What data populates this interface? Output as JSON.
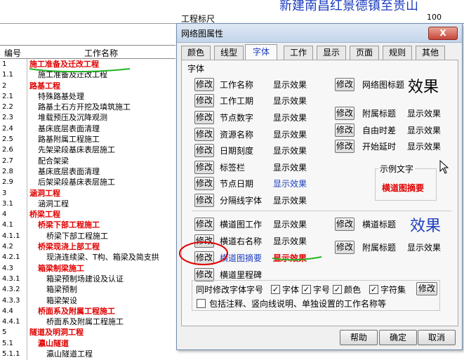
{
  "background": {
    "title": "新建南昌红景德镇至贵山",
    "gongcheng_label": "工程标尺",
    "gongcheng_value": "100",
    "headers": {
      "code": "编号",
      "name": "工作名称"
    },
    "rows": [
      {
        "code": "1",
        "name": "施工准备及迁改工程",
        "red": true,
        "indent": 0
      },
      {
        "code": "1.1",
        "name": "施工准备及迁改工程",
        "red": false,
        "indent": 1
      },
      {
        "code": "2",
        "name": "路基工程",
        "red": true,
        "indent": 0
      },
      {
        "code": "2.1",
        "name": "特殊路基处理",
        "red": false,
        "indent": 1
      },
      {
        "code": "2.2",
        "name": "路基土石方开挖及填筑施工",
        "red": false,
        "indent": 1
      },
      {
        "code": "2.3",
        "name": "堆载预压及沉降观测",
        "red": false,
        "indent": 1
      },
      {
        "code": "2.4",
        "name": "基床底层表面清理",
        "red": false,
        "indent": 1
      },
      {
        "code": "2.5",
        "name": "路基附属工程施工",
        "red": false,
        "indent": 1
      },
      {
        "code": "2.6",
        "name": "先架梁段基床表层施工",
        "red": false,
        "indent": 1
      },
      {
        "code": "2.7",
        "name": "配合架梁",
        "red": false,
        "indent": 1
      },
      {
        "code": "2.8",
        "name": "基床底层表面清理",
        "red": false,
        "indent": 1
      },
      {
        "code": "2.9",
        "name": "后架梁段基床表层施工",
        "red": false,
        "indent": 1
      },
      {
        "code": "3",
        "name": "涵洞工程",
        "red": true,
        "indent": 0
      },
      {
        "code": "3.1",
        "name": "涵洞工程",
        "red": false,
        "indent": 1
      },
      {
        "code": "4",
        "name": "桥梁工程",
        "red": true,
        "indent": 0
      },
      {
        "code": "4.1",
        "name": "桥梁下部工程施工",
        "red": true,
        "indent": 1
      },
      {
        "code": "4.1.1",
        "name": "桥梁下部工程施工",
        "red": false,
        "indent": 2
      },
      {
        "code": "4.2",
        "name": "桥梁现浇上部工程",
        "red": true,
        "indent": 1
      },
      {
        "code": "4.2.1",
        "name": "现浇连续梁、T构、箱梁及简支拱",
        "red": false,
        "indent": 2
      },
      {
        "code": "4.3",
        "name": "箱梁制梁施工",
        "red": true,
        "indent": 1
      },
      {
        "code": "4.3.1",
        "name": "箱梁预制场建设及认证",
        "red": false,
        "indent": 2
      },
      {
        "code": "4.3.2",
        "name": "箱梁预制",
        "red": false,
        "indent": 2
      },
      {
        "code": "4.3.3",
        "name": "箱梁架设",
        "red": false,
        "indent": 2
      },
      {
        "code": "4.4",
        "name": "桥面系及附属工程施工",
        "red": true,
        "indent": 1
      },
      {
        "code": "4.4.1",
        "name": "桥面系及附属工程施工",
        "red": false,
        "indent": 2
      },
      {
        "code": "5",
        "name": "隧道及明洞工程",
        "red": true,
        "indent": 0
      },
      {
        "code": "5.1",
        "name": "瀛山隧道",
        "red": true,
        "indent": 1
      },
      {
        "code": "5.1.1",
        "name": "瀛山隧道工程",
        "red": false,
        "indent": 2
      }
    ]
  },
  "dialog": {
    "title": "网络图属性",
    "close_label": "X",
    "tabs": [
      "颜色",
      "线型",
      "字体",
      "工作",
      "显示",
      "页面",
      "规则",
      "其他"
    ],
    "active_tab": "字体",
    "group_font": "字体",
    "modify_label": "修改",
    "effect_label": "显示效果",
    "left_items": [
      "工作名称",
      "工作工期",
      "节点数字",
      "资源名称",
      "日期刻度",
      "标签栏",
      "节点日期",
      "分隔线字体"
    ],
    "right_items": [
      {
        "label": "网络图标题",
        "effect": "效果"
      },
      {
        "label": "附属标题",
        "effect": "显示效果"
      },
      {
        "label": "自由时差",
        "effect": "显示效果"
      },
      {
        "label": "开始延时",
        "effect": "显示效果"
      }
    ],
    "sample_group": "示例文字",
    "sample_text": "横道图摘要",
    "bottom_left_items": [
      "横道图工作",
      "横道右名称",
      "横道图摘要",
      "横道里程碑"
    ],
    "bottom_right_items": [
      {
        "label": "横道标题",
        "effect": "效果"
      },
      {
        "label": "附属标题",
        "effect": "显示效果"
      }
    ],
    "sync_label": "同时修改字体字号",
    "checkboxes": [
      {
        "label": "字体",
        "checked": true
      },
      {
        "label": "字号",
        "checked": true
      },
      {
        "label": "颜色",
        "checked": true
      },
      {
        "label": "字符集",
        "checked": true
      }
    ],
    "include_label": "包括注释、竖向线说明、单独设置的工作名称等",
    "include_checked": false,
    "help_label": "帮助",
    "ok_label": "确定",
    "cancel_label": "取消",
    "colors": {
      "accent_blue": "#1f3fbf",
      "red": "#e00000",
      "annotation_green": "#22b422",
      "annotation_red": "#e00000"
    }
  }
}
